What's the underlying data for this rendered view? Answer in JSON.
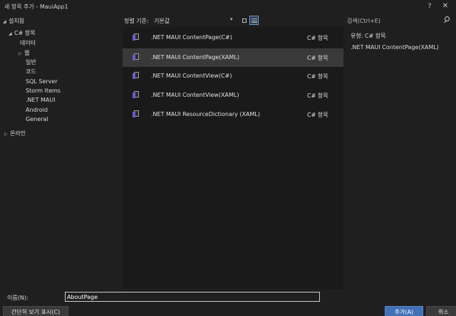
{
  "window": {
    "title": "새 항목 추가 - MauiApp1",
    "help": "?",
    "close": "✕"
  },
  "left": {
    "header": "설치됨",
    "tree": [
      {
        "label": "C# 항목",
        "toggle": "◢"
      },
      {
        "label": "데이터",
        "toggle": ""
      },
      {
        "label": "웹",
        "toggle": "▷"
      },
      {
        "label": "일반",
        "toggle": ""
      },
      {
        "label": "코드",
        "toggle": ""
      },
      {
        "label": "SQL Server",
        "toggle": ""
      },
      {
        "label": "Storm Items",
        "toggle": ""
      },
      {
        "label": ".NET MAUI",
        "toggle": ""
      },
      {
        "label": "Android",
        "toggle": ""
      },
      {
        "label": "General",
        "toggle": ""
      },
      {
        "label": "온라인",
        "toggle": "▷"
      }
    ]
  },
  "sort": {
    "label": "정렬 기준:",
    "value": "기본값",
    "arrow": "▾"
  },
  "templates": [
    {
      "name": ".NET MAUI ContentPage(C#)",
      "lang": "C# 항목",
      "selected": false
    },
    {
      "name": ".NET MAUI ContentPage(XAML)",
      "lang": "C# 항목",
      "selected": true
    },
    {
      "name": ".NET MAUI ContentView(C#)",
      "lang": "C# 항목",
      "selected": false
    },
    {
      "name": ".NET MAUI ContentView(XAML)",
      "lang": "C# 항목",
      "selected": false
    },
    {
      "name": ".NET MAUI ResourceDictionary (XAML)",
      "lang": "C# 항목",
      "selected": false
    }
  ],
  "right": {
    "search_placeholder": "검색(Ctrl+E)",
    "type_line": "유형:  C# 항목",
    "description": ".NET MAUI ContentPage(XAML)"
  },
  "bottom": {
    "name_label": "이름(N):",
    "name_value": "AboutPage",
    "compact_label": "간단히 보기 표시(C)",
    "add_label": "추가(A)",
    "cancel_label": "취소"
  },
  "colors": {
    "accent": "#4070b8",
    "selected_row": "#393939",
    "background": "#1f1f1f"
  }
}
